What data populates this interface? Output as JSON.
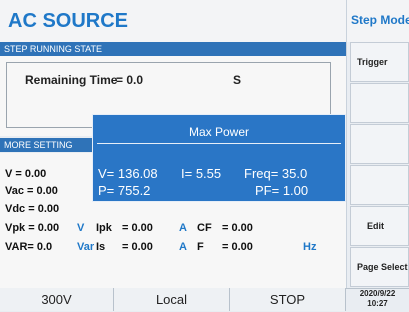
{
  "header": {
    "title": "AC SOURCE",
    "step_title": "Step Mode"
  },
  "running_state": {
    "bar_label": "STEP RUNNING STATE",
    "remaining_label": "Remaining Time",
    "remaining_value": "= 0.0",
    "unit": "S"
  },
  "more_settings": {
    "bar_label": "MORE SETTING",
    "rows": {
      "v": "V     = 0.00",
      "vac": "Vac = 0.00",
      "vdc": "Vdc = 0.00",
      "vpk": "Vpk = 0.00",
      "var": "VAR= 0.0"
    },
    "vpk_row": {
      "v": "V",
      "ipk": "Ipk",
      "ipk_val": "= 0.00",
      "a": "A",
      "cf": "CF",
      "cf_val": "= 0.00"
    },
    "var_row": {
      "var": "Var",
      "is": "Is",
      "is_val": "= 0.00",
      "a": "A",
      "f": "F",
      "f_val": "= 0.00",
      "hz": "Hz"
    }
  },
  "popup": {
    "title": "Max Power",
    "v": "V= 136.08",
    "i": "I= 5.55",
    "freq": "Freq= 35.0",
    "p": "P= 755.2",
    "pf": "PF= 1.00"
  },
  "side_buttons": {
    "trigger": "Trigger",
    "blank1": "",
    "blank2": "",
    "blank3": "",
    "edit": "Edit",
    "page_select": "Page Select"
  },
  "footer": {
    "range": "300V",
    "mode": "Local",
    "state": "STOP",
    "date": "2020/9/22",
    "time": "10:27"
  },
  "colors": {
    "accent": "#1f78c8",
    "bar": "#2f73b8",
    "popup": "#2a76c6"
  }
}
